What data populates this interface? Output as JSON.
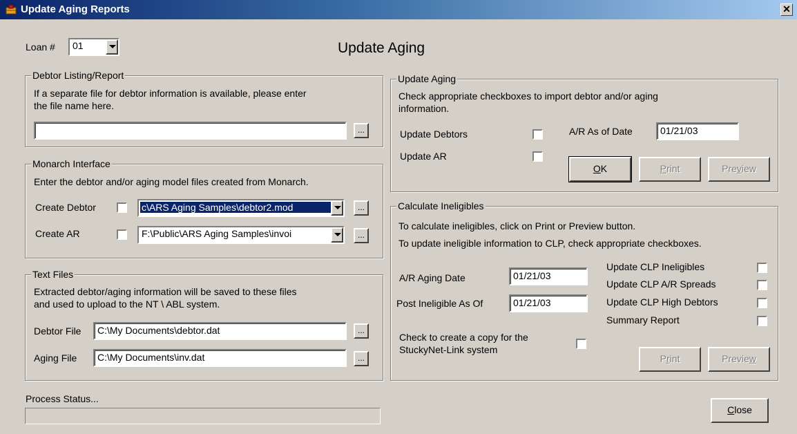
{
  "window": {
    "title": "Update Aging Reports",
    "close_glyph": "✕"
  },
  "heading": "Update Aging",
  "loan": {
    "label": "Loan #",
    "value": "01"
  },
  "debtor_listing": {
    "legend": "Debtor Listing/Report",
    "desc1": "If a separate file for debtor information is available, please enter",
    "desc2": "the file name here.",
    "file_value": "",
    "browse": "..."
  },
  "monarch": {
    "legend": "Monarch Interface",
    "desc": "Enter the debtor and/or aging model files created from Monarch.",
    "create_debtor_label": "Create Debtor",
    "create_debtor_value": "c\\ARS Aging Samples\\debtor2.mod",
    "create_ar_label": "Create AR",
    "create_ar_value": "F:\\Public\\ARS Aging Samples\\invoi",
    "browse": "..."
  },
  "text_files": {
    "legend": "Text Files",
    "desc1": "Extracted debtor/aging information will be saved to these files",
    "desc2": "and used to upload to the NT \\ ABL system.",
    "debtor_file_label": "Debtor File",
    "debtor_file_value": "C:\\My Documents\\debtor.dat",
    "aging_file_label": "Aging File",
    "aging_file_value": "C:\\My Documents\\inv.dat",
    "browse": "..."
  },
  "update_aging": {
    "legend": "Update Aging",
    "desc1": "Check appropriate checkboxes to import debtor and/or aging",
    "desc2": "information.",
    "update_debtors_label": "Update Debtors",
    "update_ar_label": "Update AR",
    "ar_date_label": "A/R As of Date",
    "ar_date_value": "01/21/03",
    "ok": {
      "mn": "O",
      "rest": "K"
    },
    "print": {
      "mn": "P",
      "rest": "rint"
    },
    "preview": {
      "pre": "Pre",
      "mn": "v",
      "rest": "iew"
    }
  },
  "ineligibles": {
    "legend": "Calculate Ineligibles",
    "desc1": "To calculate ineligibles, click on Print or Preview button.",
    "desc2": "To update ineligible information to CLP, check appropriate checkboxes.",
    "ar_aging_label": "A/R Aging Date",
    "ar_aging_value": "01/21/03",
    "post_label": "Post Ineligible As Of",
    "post_value": "01/21/03",
    "copy_label1": "Check to create a copy for the",
    "copy_label2": "StuckyNet-Link system",
    "cb_ineligibles": "Update CLP Ineligibles",
    "cb_spreads": "Update CLP A/R Spreads",
    "cb_high": "Update CLP High Debtors",
    "cb_summary": "Summary Report",
    "print": {
      "pre": "P",
      "mn": "r",
      "rest": "int"
    },
    "preview": {
      "pre": "Previe",
      "mn": "w",
      "rest": ""
    }
  },
  "status": {
    "label": "Process Status...",
    "progress": 0
  },
  "close": {
    "mn": "C",
    "rest": "lose"
  }
}
